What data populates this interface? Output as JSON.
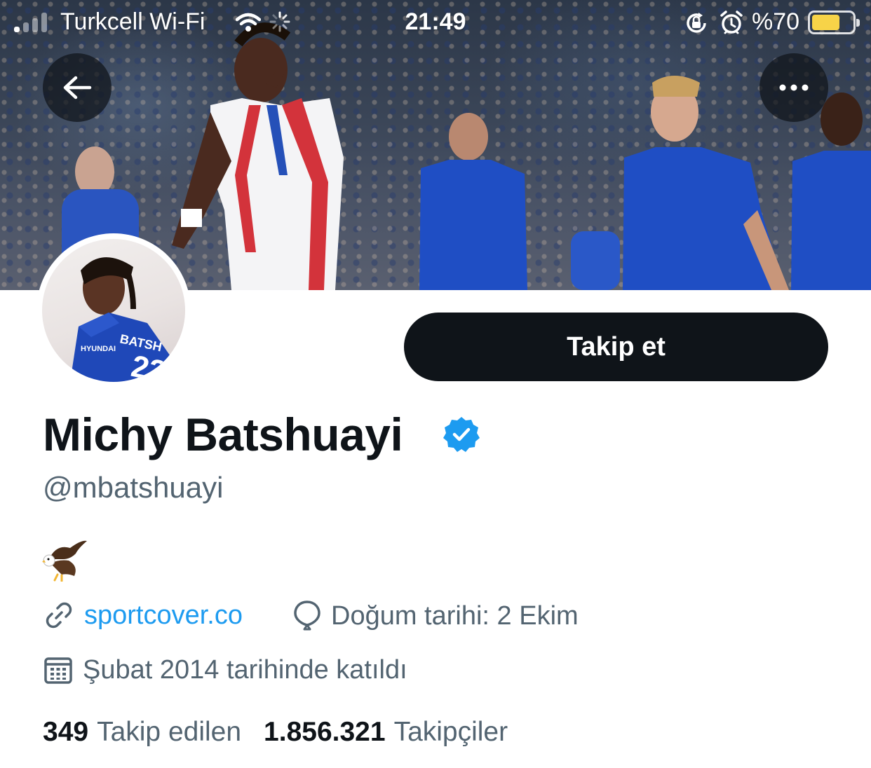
{
  "status_bar": {
    "carrier": "Turkcell Wi-Fi",
    "time": "21:49",
    "battery_percent": "%70",
    "battery_level": 0.7,
    "battery_color": "#f7d348",
    "icons": [
      "signal-icon",
      "wifi-icon",
      "spinner-icon",
      "rotation-lock-icon",
      "alarm-icon",
      "battery-icon"
    ]
  },
  "header": {
    "back_icon": "arrow-left-icon",
    "more_icon": "more-horizontal-icon"
  },
  "profile": {
    "follow_label": "Takip et",
    "name": "Michy Batshuayi",
    "verified": true,
    "verified_color": "#1d9bf0",
    "handle": "@mbatshuayi",
    "bio_emoji": "eagle",
    "website": "sportcover.co",
    "birthday": "Doğum tarihi: 2 Ekim",
    "joined": "Şubat 2014 tarihinde katıldı",
    "following_count": "349",
    "following_label": "Takip edilen",
    "followers_count": "1.856.321",
    "followers_label": "Takipçiler"
  },
  "colors": {
    "primary_text": "#0f1419",
    "secondary_text": "#536471",
    "link": "#1d9bf0",
    "button_bg": "#0f1419"
  }
}
